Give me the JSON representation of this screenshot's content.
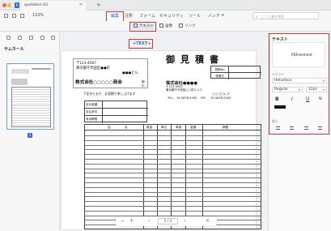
{
  "window": {
    "doc_tab_title": "quotation-03",
    "doc_tab_close": "×",
    "new_tab": "+"
  },
  "toolbar": {
    "zoom": "110%",
    "menu": [
      "編集",
      "注釈",
      "フォーム",
      "セキュリティ",
      "ツール",
      "バッチ"
    ],
    "batch_chevron": "▾",
    "search_placeholder": "ここに書き検索",
    "tools": [
      "テキスト",
      "画像",
      "リンク"
    ]
  },
  "sidebar": {
    "title": "サムネール",
    "page_badge": "1"
  },
  "canvas": {
    "text_marker": "+TEXT+",
    "addr_postal": "〒123-4567",
    "addr_line": "東京都千代田区●●町",
    "addr_bldg": "●●●ビル",
    "company": "株式会社○○○○○商会",
    "honorific": "御中",
    "doc_title": "御見積書",
    "label_1": "見積No",
    "label_2": "見積日",
    "issuer_name": "株式会社●●●●",
    "issuer_postal": "〒123-4567",
    "issuer_addr": "東京都千代田区○○町1-2-3",
    "issuer_bldg": "○○○ビル○F",
    "issuer_tel": "TEL：",
    "issuer_tel_no": "19-5678-5432",
    "issuer_fax": "FM：",
    "issuer_fax_no": "19-5678-5432",
    "intro": "下記のとおり、お見積り申し上げます",
    "info_rows": [
      "合計金額",
      "支払条件",
      "有効期限"
    ],
    "table_headers": [
      "品",
      "名",
      "数量",
      "単位",
      "単価",
      "金額",
      "摘要"
    ]
  },
  "bottom_bar": {
    "zoom_out": "−",
    "zoom_in": "+",
    "prev": "‹",
    "page": "1 / 1",
    "next": "›",
    "close": "×"
  },
  "right_panel": {
    "title": "テキスト",
    "font_preview": "PDFelement",
    "font_label": "テキスト",
    "font_name": "Helvetica",
    "weight": "Regular",
    "size": "12pt",
    "bold": "B",
    "italic": "I",
    "underline": "U",
    "align_label": "揃え"
  }
}
